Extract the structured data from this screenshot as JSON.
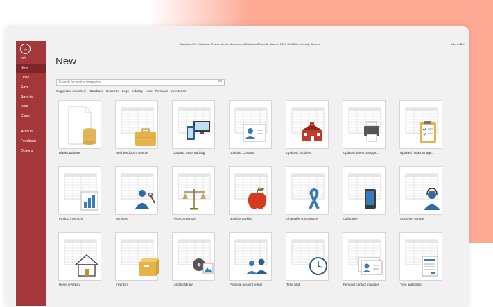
{
  "window": {
    "title": "Database50 : Database- C:\\Users\\mckel\\Documents\\Database50.accdb (Access 2007 - 2016 file format) - Access",
    "user": "Michel Bar"
  },
  "sidebar": {
    "items": [
      {
        "label": "Info"
      },
      {
        "label": "New",
        "active": true
      },
      {
        "label": "Open"
      },
      {
        "label": "Save"
      },
      {
        "label": "Save As"
      },
      {
        "label": "Print"
      },
      {
        "label": "Close"
      },
      {
        "label": "Account"
      },
      {
        "label": "Feedback"
      },
      {
        "label": "Options"
      }
    ],
    "color": "#a4373a"
  },
  "page": {
    "title": "New"
  },
  "search": {
    "placeholder": "Search for online templates"
  },
  "supported": {
    "label": "Suggested searches:",
    "links": [
      "Database",
      "Business",
      "Logs",
      "Industry",
      "Lists",
      "Personal",
      "Inventories"
    ]
  },
  "templates": [
    {
      "label": "Blank database",
      "icon": "blank-doc-db-icon"
    },
    {
      "label": "Northwind 2007 sample",
      "icon": "briefcase-icon"
    },
    {
      "label": "Updated: Asset tracking",
      "icon": "devices-icon"
    },
    {
      "label": "Updated: Contacts",
      "icon": "contact-card-icon"
    },
    {
      "label": "Updated: Students",
      "icon": "school-icon"
    },
    {
      "label": "Updated: Event manage...",
      "icon": "printer-icon"
    },
    {
      "label": "Updated: Task manage...",
      "icon": "clipboard-icon"
    },
    {
      "label": "Product inventory",
      "icon": "bar-chart-doc-icon"
    },
    {
      "label": "Services",
      "icon": "worker-wrench-icon"
    },
    {
      "label": "Price comparison",
      "icon": "scales-icon"
    },
    {
      "label": "Nutrition tracking",
      "icon": "apple-icon"
    },
    {
      "label": "Charitable contributions",
      "icon": "ribbon-icon"
    },
    {
      "label": "Call tracker",
      "icon": "phone-icon"
    },
    {
      "label": "Customer service",
      "icon": "headset-person-icon"
    },
    {
      "label": "Home inventory",
      "icon": "house-icon"
    },
    {
      "label": "Inventory",
      "icon": "box-icon"
    },
    {
      "label": "Lending library",
      "icon": "media-icon"
    },
    {
      "label": "Personal account ledger",
      "icon": "people-icon"
    },
    {
      "label": "Time card",
      "icon": "clock-icon"
    },
    {
      "label": "Personal contact manager",
      "icon": "contact-cards-icon"
    },
    {
      "label": "Time and billing",
      "icon": "invoice-icon"
    }
  ]
}
